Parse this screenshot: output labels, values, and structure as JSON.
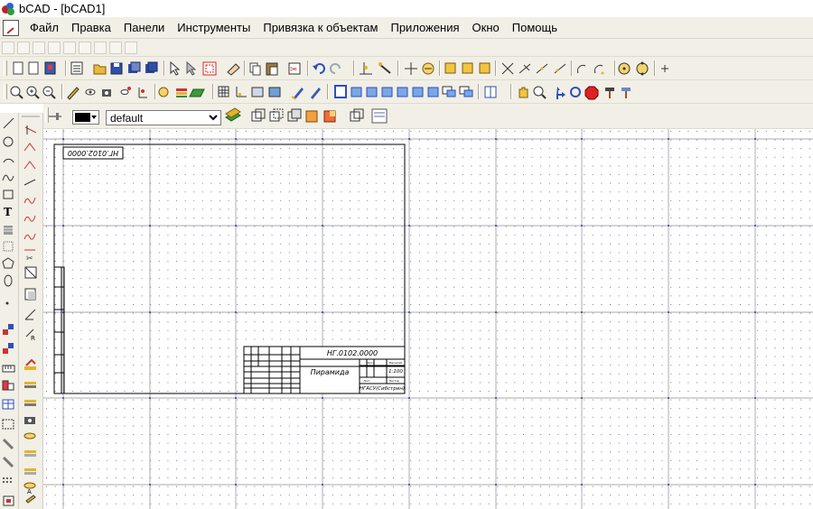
{
  "window": {
    "title": "bCAD - [bCAD1]"
  },
  "menu": {
    "items": [
      "Файл",
      "Правка",
      "Панели",
      "Инструменты",
      "Привязка к объектам",
      "Приложения",
      "Окно",
      "Помощь"
    ]
  },
  "properties_bar": {
    "layer_value": "default",
    "layer_options": [
      "default"
    ]
  },
  "drawing": {
    "stamp_code_top": "НГ.0102.0000",
    "stamp_code_main": "НГ.0102.0000",
    "part_name": "Пирамида",
    "organization": "НГАСУ(Сибстрин)",
    "scale": "1:100",
    "sheet_label": "Лист",
    "sheets_label": "Листов",
    "mass_label": "Масса",
    "scale_label": "Масштаб"
  },
  "colors": {
    "background": "#ffffff",
    "toolbar_bg": "#f1efe6",
    "grid_line": "#8c8c8c",
    "grid_dot": "#2a3aa8",
    "frame": "#000000"
  }
}
